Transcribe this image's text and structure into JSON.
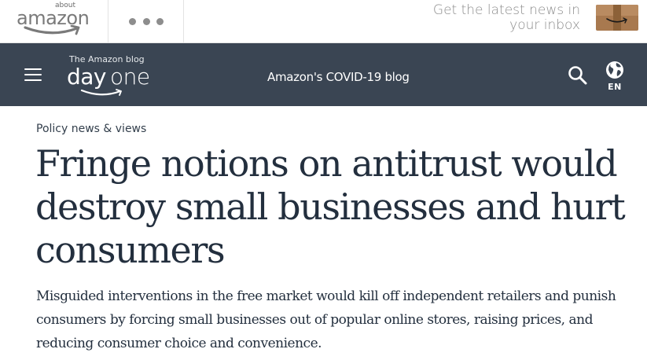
{
  "header": {
    "logo_about": "about",
    "logo_word": "amazon",
    "promo_line1": "Get the latest news in",
    "promo_line2": "your inbox"
  },
  "nav": {
    "blog_subtitle": "The Amazon blog",
    "brand_day": "day",
    "brand_one": "one",
    "covid_link": "Amazon's COVID-19 blog",
    "language": "EN"
  },
  "article": {
    "category": "Policy news & views",
    "headline": "Fringe notions on antitrust would destroy small businesses and hurt consumers",
    "dek": "Misguided interventions in the free market would kill off independent retailers and punish consumers by forcing small businesses out of popular online stores, raising prices, and reducing consumer choice and convenience."
  },
  "icons": {
    "menu": "hamburger-icon",
    "more": "ellipsis-icon",
    "search": "search-icon",
    "language": "globe-icon",
    "newsletter": "package-box-icon"
  },
  "colors": {
    "nav_background": "#3a4553",
    "text_primary": "#232f3e",
    "logo_gray": "#7a7a7a",
    "box_brown": "#a8794f"
  }
}
